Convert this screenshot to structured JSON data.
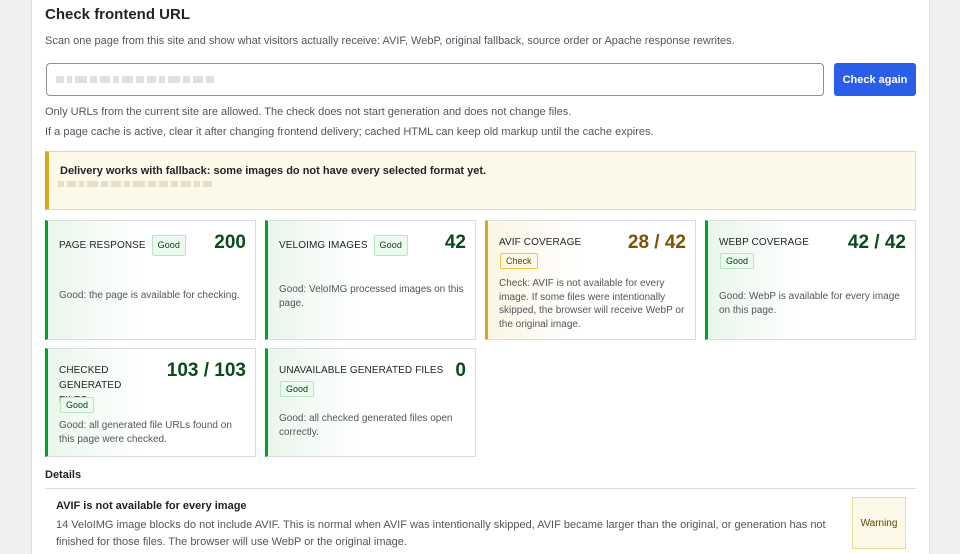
{
  "header": {
    "title": "Check frontend URL",
    "description": "Scan one page from this site and show what visitors actually receive: AVIF, WebP, original fallback, source order or Apache response rewrites."
  },
  "form": {
    "url_value": "",
    "check_button": "Check again"
  },
  "notes": {
    "line1": "Only URLs from the current site are allowed. The check does not start generation and does not change files.",
    "line2": "If a page cache is active, clear it after changing frontend delivery; cached HTML can keep old markup until the cache expires."
  },
  "notice": {
    "text": "Delivery works with fallback: some images do not have every selected format yet."
  },
  "cards": [
    {
      "label": "PAGE RESPONSE",
      "badge": "Good",
      "value": "200",
      "desc": "Good: the page is available for checking."
    },
    {
      "label": "VELOIMG IMAGES",
      "badge": "Good",
      "value": "42",
      "desc": "Good: VeloIMG processed images on this page."
    },
    {
      "label": "AVIF COVERAGE",
      "badge": "Check",
      "value": "28 / 42",
      "desc": "Check: AVIF is not available for every image. If some files were intentionally skipped, the browser will receive WebP or the original image."
    },
    {
      "label": "WEBP COVERAGE",
      "badge": "Good",
      "value": "42 / 42",
      "desc": "Good: WebP is available for every image on this page."
    },
    {
      "label": "CHECKED GENERATED FILES",
      "badge": "Good",
      "value": "103 / 103",
      "desc": "Good: all generated file URLs found on this page were checked."
    },
    {
      "label": "UNAVAILABLE GENERATED FILES",
      "badge": "Good",
      "value": "0",
      "desc": "Good: all checked generated files open correctly."
    }
  ],
  "details": {
    "title": "Details",
    "issue_title": "AVIF is not available for every image",
    "issue_desc": "14 VeloIMG image blocks do not include AVIF. This is normal when AVIF was intentionally skipped, AVIF became larger than the original, or generation has not finished for those files. The browser will use WebP or the original image.",
    "issue_badge": "Warning"
  },
  "colors": {
    "accent": "#2b5ee8",
    "good": "#00a32a",
    "warning": "#dba617"
  }
}
